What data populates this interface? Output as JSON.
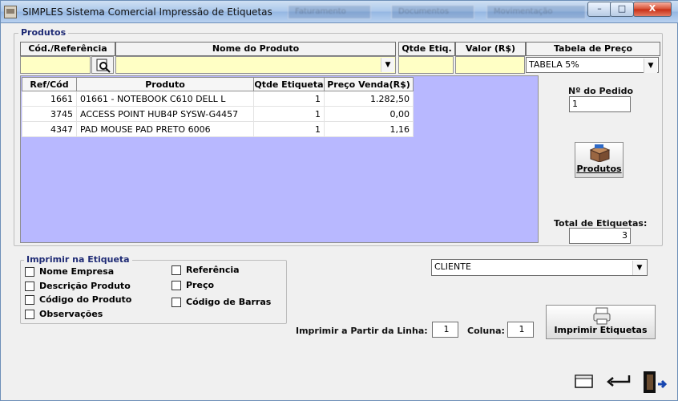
{
  "window": {
    "title": "SIMPLES Sistema Comercial Impressão de Etiquetas",
    "bg_tabs": [
      "Faturamento",
      "Documentos",
      "Movimentação"
    ],
    "controls": {
      "minimize": "–",
      "maximize": "□",
      "close": "X"
    }
  },
  "produtos": {
    "legend": "Produtos",
    "headers": {
      "cod": "Cód./Referência",
      "nome": "Nome do Produto",
      "qtde": "Qtde Etiq.",
      "valor": "Valor (R$)",
      "tabela": "Tabela de Preço"
    },
    "tabela_value": "TABELA 5%",
    "grid_columns": [
      "Ref/Cód",
      "Produto",
      "Qtde Etiqueta",
      "Preço Venda(R$)"
    ],
    "rows": [
      {
        "ref": "1661",
        "produto": "01661 - NOTEBOOK  C610    DELL  L",
        "qtde": "1",
        "preco": "1.282,50"
      },
      {
        "ref": "3745",
        "produto": "ACCESS POINT  HUB4P SYSW-G4457",
        "qtde": "1",
        "preco": "0,00"
      },
      {
        "ref": "4347",
        "produto": "PAD MOUSE PAD PRETO        6006",
        "qtde": "1",
        "preco": "1,16"
      }
    ],
    "pedido_label": "Nº do Pedido",
    "pedido_value": "1",
    "produtos_button": "Produtos",
    "total_label": "Total de Etiquetas:",
    "total_value": "3"
  },
  "imprimir": {
    "legend": "Imprimir na Etiqueta",
    "options_left": [
      "Nome Empresa",
      "Descrição Produto",
      "Código do Produto",
      "Observações"
    ],
    "options_right": [
      "Referência",
      "Preço",
      "Código de Barras"
    ]
  },
  "cliente": {
    "value": "CLIENTE"
  },
  "print_from": {
    "linha_label": "Imprimir a Partir da Linha:",
    "linha_value": "1",
    "coluna_label": "Coluna:",
    "coluna_value": "1"
  },
  "buttons": {
    "imprimir_etiquetas": "Imprimir Etiquetas"
  },
  "icons": [
    "window-icon",
    "search-icon",
    "box-icon",
    "printer-icon",
    "calendar-icon",
    "return-arrow-icon",
    "exit-door-icon"
  ]
}
